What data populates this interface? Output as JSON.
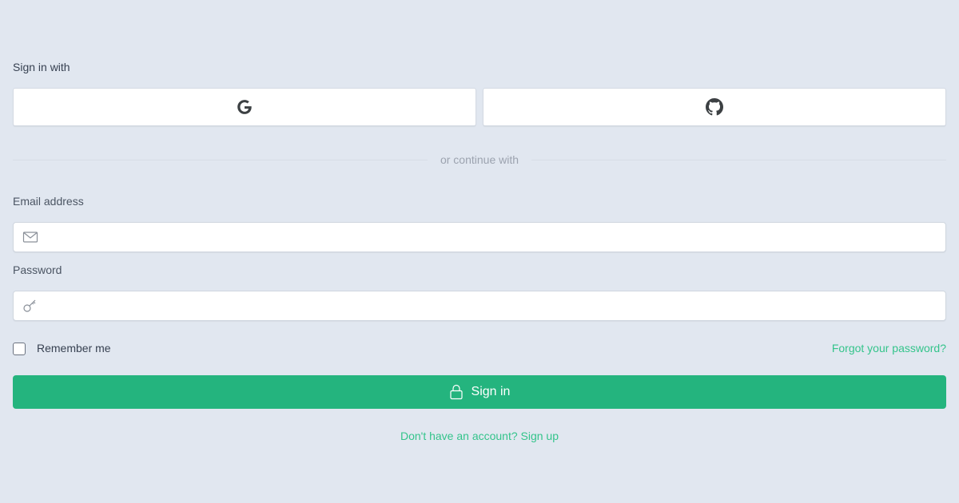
{
  "auth": {
    "social_heading": "Sign in with",
    "providers": [
      {
        "name": "Google",
        "icon": "google-icon"
      },
      {
        "name": "GitHub",
        "icon": "github-icon"
      }
    ],
    "divider_text": "or continue with",
    "email": {
      "label": "Email address",
      "value": "",
      "placeholder": "",
      "icon": "mail-icon"
    },
    "password": {
      "label": "Password",
      "value": "",
      "placeholder": "",
      "icon": "key-icon"
    },
    "remember_label": "Remember me",
    "remember_checked": false,
    "forgot_link": "Forgot your password?",
    "submit_label": "Sign in",
    "submit_icon": "lock-icon",
    "signup_link": "Don't have an account? Sign up"
  },
  "colors": {
    "background": "#e1e7f0",
    "brand": "#24b47e",
    "link": "#34c48b"
  }
}
